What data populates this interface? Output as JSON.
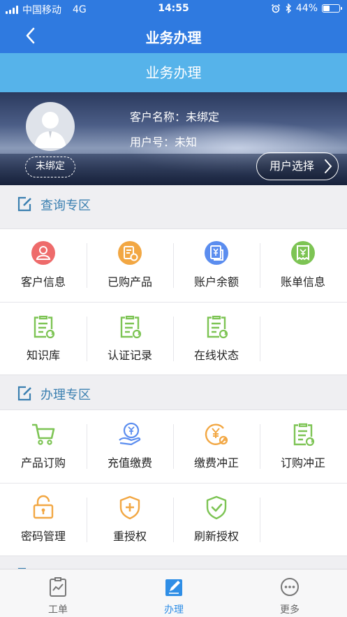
{
  "status_bar": {
    "carrier": "中国移动",
    "network": "4G",
    "time": "14:55",
    "battery": "44%",
    "battery_level": 0.44
  },
  "nav": {
    "title": "业务办理"
  },
  "sub_header": {
    "title": "业务办理"
  },
  "customer": {
    "name_label": "客户名称：",
    "name_value": "未绑定",
    "id_label": "用户号：",
    "id_value": "未知",
    "status_tag": "未绑定",
    "select_button": "用户选择"
  },
  "query_section": {
    "title": "查询专区",
    "items": [
      {
        "label": "客户信息",
        "icon": "customer-info-icon"
      },
      {
        "label": "已购产品",
        "icon": "purchased-products-icon"
      },
      {
        "label": "账户余额",
        "icon": "account-balance-icon"
      },
      {
        "label": "账单信息",
        "icon": "bill-info-icon"
      },
      {
        "label": "知识库",
        "icon": "knowledge-base-icon"
      },
      {
        "label": "认证记录",
        "icon": "auth-records-icon"
      },
      {
        "label": "在线状态",
        "icon": "online-status-icon"
      }
    ]
  },
  "handle_section": {
    "title": "办理专区",
    "items": [
      {
        "label": "产品订购",
        "icon": "cart-icon"
      },
      {
        "label": "充值缴费",
        "icon": "recharge-icon"
      },
      {
        "label": "缴费冲正",
        "icon": "payment-reversal-icon"
      },
      {
        "label": "订购冲正",
        "icon": "order-reversal-icon"
      },
      {
        "label": "密码管理",
        "icon": "lock-icon"
      },
      {
        "label": "重授权",
        "icon": "shield-plus-icon"
      },
      {
        "label": "刷新授权",
        "icon": "shield-check-icon"
      }
    ]
  },
  "tabs": [
    {
      "label": "工单",
      "icon": "work-order-icon",
      "active": false
    },
    {
      "label": "办理",
      "icon": "handle-icon",
      "active": true
    },
    {
      "label": "更多",
      "icon": "more-icon",
      "active": false
    }
  ],
  "colors": {
    "primary": "#2f7ae0",
    "sub_header": "#56b3ea",
    "section_title": "#3a7fb0",
    "tab_active": "#2f8ee6",
    "red": "#ee6b6b",
    "orange": "#f2a743",
    "blue": "#5b8def",
    "green": "#7dc454"
  }
}
